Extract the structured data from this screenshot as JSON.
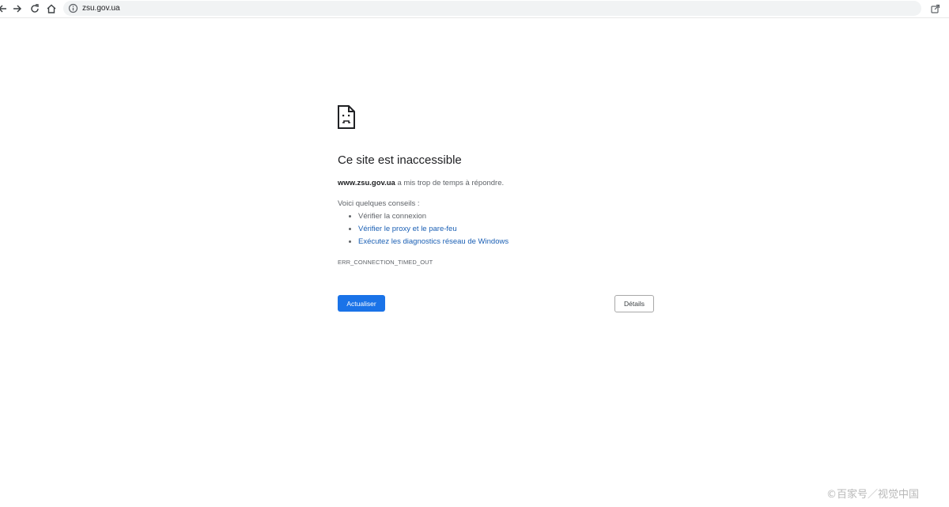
{
  "browser": {
    "url": "zsu.gov.ua",
    "icons": {
      "back": "arrow-left-icon",
      "forward": "arrow-right-icon",
      "reload": "reload-icon",
      "home": "home-icon",
      "site_info": "info-icon",
      "share": "share-icon"
    }
  },
  "error_page": {
    "icon": "sad-page-icon",
    "title": "Ce site est inaccessible",
    "summary_host": "www.zsu.gov.ua",
    "summary_text": " a mis trop de temps à répondre.",
    "tips_label": "Voici quelques conseils :",
    "tips": [
      {
        "label": "Vérifier la connexion",
        "link": false
      },
      {
        "label": "Vérifier le proxy et le pare-feu",
        "link": true
      },
      {
        "label": "Exécutez les diagnostics réseau de Windows",
        "link": true
      }
    ],
    "error_code": "ERR_CONNECTION_TIMED_OUT",
    "reload_label": "Actualiser",
    "details_label": "Détails"
  },
  "watermark": "©百家号／视觉中国",
  "colors": {
    "primary_button": "#1a73e8",
    "link": "#1a5fb4",
    "text_secondary": "#5f6368"
  }
}
